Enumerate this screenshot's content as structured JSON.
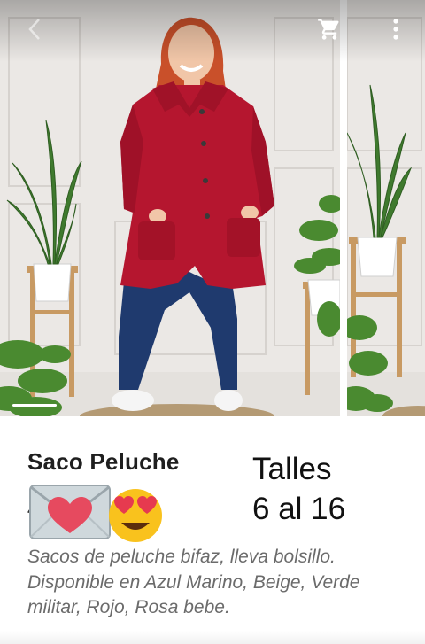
{
  "gallery": {
    "icons": {
      "back": "chevron-left-icon",
      "cart": "shopping-cart-icon",
      "menu": "more-vert-icon"
    }
  },
  "post": {
    "title": "Saco Peluche",
    "title_stub": "4",
    "emojis": [
      "love-letter-emoji",
      "heart-eyes-emoji"
    ],
    "sizes_line1": "Talles",
    "sizes_line2": "6 al 16",
    "description_line1": "Sacos de peluche bifaz, lleva bolsillo.",
    "description_line2": "Disponible en Azul Marino, Beige, Verde",
    "description_line3": "militar, Rojo, Rosa bebe."
  },
  "colors": {
    "coat": "#b5162f",
    "jeans": "#1f3a6e",
    "wall": "#ece9e6",
    "caption_text": "#6b6b6b"
  }
}
